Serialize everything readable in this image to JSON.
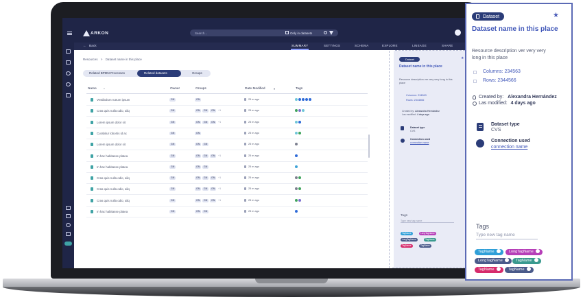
{
  "app": {
    "logo": "ARKON",
    "search_placeholder": "Search...",
    "only_datasets": "Only in datasets",
    "back": "Back",
    "tabs": [
      "SUMMARY",
      "SETTINGS",
      "SCHEMA",
      "EXPLORE",
      "LINEAGE",
      "SHARE"
    ],
    "active_tab": "SUMMARY"
  },
  "breadcrumb": {
    "root": "Resources",
    "sep": ">",
    "current": "Dataset name in this place"
  },
  "subtabs": [
    "Related BPMN Processes",
    "Related datasets",
    "Groups"
  ],
  "active_subtab": "Related datasets",
  "table": {
    "headers": [
      "Name",
      "Owner",
      "Groups",
      "Date Modified",
      "Tags"
    ],
    "rows": [
      {
        "name": "Vestibulum rutrum ipsum",
        "owner": "GN",
        "groups": [
          "GN"
        ],
        "extra": "",
        "date": "25 m ago",
        "tags": [
          "#6fc6d8",
          "#2f6bd8",
          "#2f6bd8",
          "#2f6bd8",
          "#2f6bd8"
        ]
      },
      {
        "name": "Cras quis nulla odio, aliq",
        "owner": "GN",
        "groups": [
          "GN",
          "GN",
          "GN"
        ],
        "extra": "+1",
        "date": "25 m ago",
        "tags": [
          "#3fa35c",
          "#7c6fd0",
          "#6fc6d8"
        ]
      },
      {
        "name": "Lorem ipsum dolor sit",
        "owner": "GN",
        "groups": [
          "GN",
          "GN",
          "GN"
        ],
        "extra": "+1",
        "date": "25 m ago",
        "tags": [
          "#6fc6d8",
          "#2f6bd8"
        ]
      },
      {
        "name": "Curabitur lobortis id ac",
        "owner": "GN",
        "groups": [
          "GN"
        ],
        "extra": "",
        "date": "25 m ago",
        "tags": [
          "#6fc6d8",
          "#3fa35c"
        ]
      },
      {
        "name": "Lorem ipsum dolor sit",
        "owner": "GN",
        "groups": [
          "GN",
          "GN"
        ],
        "extra": "",
        "date": "25 m ago",
        "tags": [
          "#7c7f8f"
        ]
      },
      {
        "name": "In hac habitasse platea",
        "owner": "GN",
        "groups": [
          "GN",
          "GN",
          "GN"
        ],
        "extra": "+1",
        "date": "25 m ago",
        "tags": [
          "#2f6bd8"
        ]
      },
      {
        "name": "In hac habitasse platea",
        "owner": "GN",
        "groups": [
          "GN",
          "GN"
        ],
        "extra": "",
        "date": "25 m ago",
        "tags": [
          "#3fa3d8"
        ]
      },
      {
        "name": "Cras quis nulla odio, aliq",
        "owner": "GN",
        "groups": [
          "GN",
          "GN",
          "GN"
        ],
        "extra": "+1",
        "date": "25 m ago",
        "tags": [
          "#7c7f8f",
          "#3fa35c"
        ]
      },
      {
        "name": "Cras quis nulla odio, aliq",
        "owner": "GN",
        "groups": [
          "GN",
          "GN",
          "GN"
        ],
        "extra": "+1",
        "date": "25 m ago",
        "tags": [
          "#7c7f8f",
          "#3fa35c"
        ]
      },
      {
        "name": "Cras quis nulla odio, aliq",
        "owner": "GN",
        "groups": [
          "GN",
          "GN",
          "GN"
        ],
        "extra": "+1",
        "date": "25 m ago",
        "tags": [
          "#3fa35c",
          "#7c6fd0"
        ]
      },
      {
        "name": "In hac habitasse platea",
        "owner": "GN",
        "groups": [
          "GN",
          "GN"
        ],
        "extra": "",
        "date": "25 m ago",
        "tags": [
          "#2f6bd8"
        ]
      }
    ]
  },
  "panel": {
    "badge": "Dataset",
    "title": "Dataset name in this place",
    "description": "Resource description ver very very long in this place",
    "columns": "Columns: 234563",
    "rows": "Rows: 2344566",
    "created_label": "Created by:",
    "created_value": "Alexandra Hernández",
    "modified_label": "Las modified:",
    "modified_value": "4 days ago",
    "type_label": "Dataset type",
    "type_value": "CVS",
    "conn_label": "Connection used",
    "conn_value": "connection name",
    "tags_label": "Tags",
    "tag_placeholder": "Type new tag name",
    "tags": [
      {
        "label": "TagName",
        "color": "#2f9fd8"
      },
      {
        "label": "LongTagName",
        "color": "#b63fb8"
      },
      {
        "label": "LongTagName",
        "color": "#4a5a8a"
      },
      {
        "label": "TagName",
        "color": "#3a9a8f"
      },
      {
        "label": "TagName",
        "color": "#d62a6b"
      },
      {
        "label": "TagName",
        "color": "#4a5a8a"
      }
    ]
  }
}
